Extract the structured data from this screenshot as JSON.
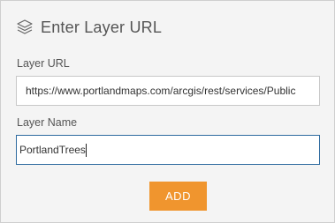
{
  "header": {
    "icon": "layers-icon",
    "title": "Enter Layer URL"
  },
  "form": {
    "url_label": "Layer URL",
    "url_value": "https://www.portlandmaps.com/arcgis/rest/services/Public",
    "name_label": "Layer Name",
    "name_value": "PortlandTrees",
    "add_label": "ADD"
  },
  "colors": {
    "accent_button": "#f0952e",
    "focus_border": "#2d6a9f",
    "panel_background": "#f4f4f4"
  }
}
